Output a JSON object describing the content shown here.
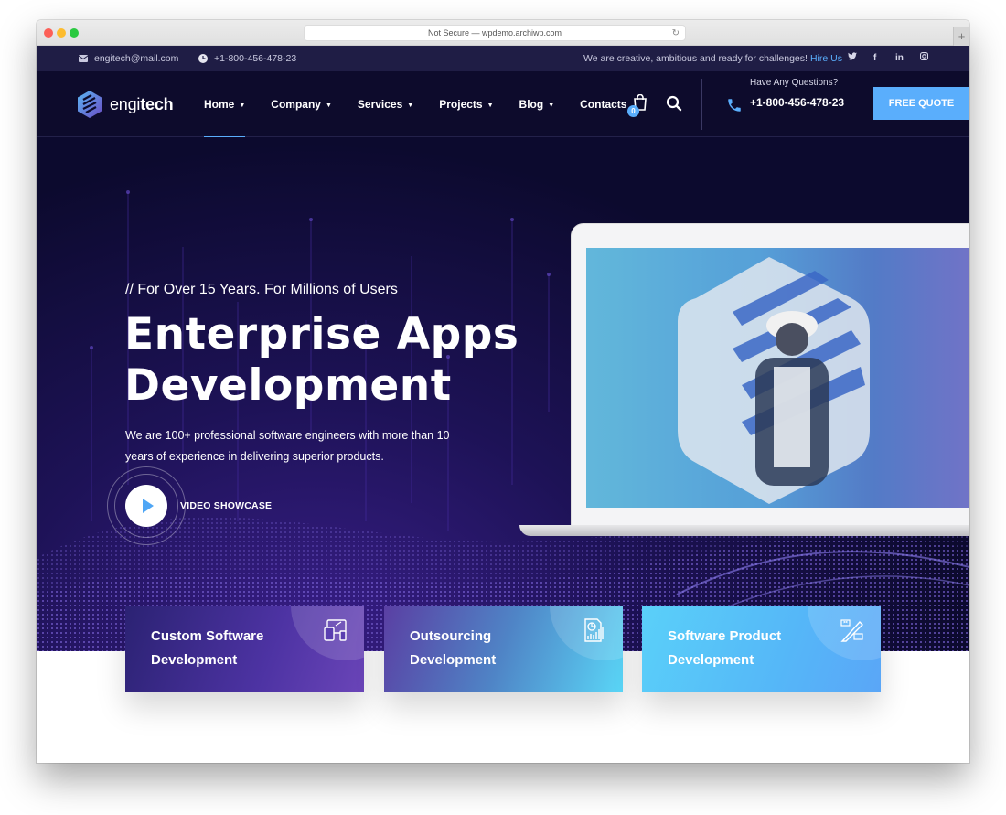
{
  "browser": {
    "address": "Not Secure — wpdemo.archiwp.com",
    "new_tab": "+"
  },
  "topbar": {
    "email": "engitech@mail.com",
    "phone": "+1-800-456-478-23",
    "slogan": "We are creative, ambitious and ready for challenges!",
    "hire_link": "Hire Us",
    "social": [
      "twitter",
      "facebook",
      "linkedin",
      "instagram"
    ],
    "social_labels": {
      "twitter": "🐦",
      "facebook": "f",
      "linkedin": "in",
      "instagram": "◎"
    }
  },
  "nav": {
    "logo_light": "engi",
    "logo_bold": "tech",
    "items": [
      {
        "label": "Home",
        "dropdown": true,
        "active": true
      },
      {
        "label": "Company",
        "dropdown": true
      },
      {
        "label": "Services",
        "dropdown": true
      },
      {
        "label": "Projects",
        "dropdown": true
      },
      {
        "label": "Blog",
        "dropdown": true
      },
      {
        "label": "Contacts",
        "dropdown": false
      }
    ],
    "caret": "▼",
    "cart_count": "0",
    "question_label": "Have Any Questions?",
    "question_phone": "+1-800-456-478-23",
    "cta": "FREE QUOTE"
  },
  "hero": {
    "tagline": "// For Over 15 Years. For Millions of Users",
    "headline_line1": "Enterprise Apps",
    "headline_line2": "Development",
    "description": "We are 100+ professional software engineers with more than 10 years of experience in delivering superior products.",
    "video_label": "VIDEO SHOWCASE"
  },
  "cards": [
    {
      "title": "Custom Software Development",
      "icon": "devices-icon"
    },
    {
      "title": "Outsourcing Development",
      "icon": "report-chart-icon"
    },
    {
      "title": "Software Product Development",
      "icon": "code-pencil-icon"
    }
  ],
  "colors": {
    "accent": "#5aaefc",
    "topbar_bg": "#1f1d45",
    "nav_bg": "#0d0b2c"
  }
}
